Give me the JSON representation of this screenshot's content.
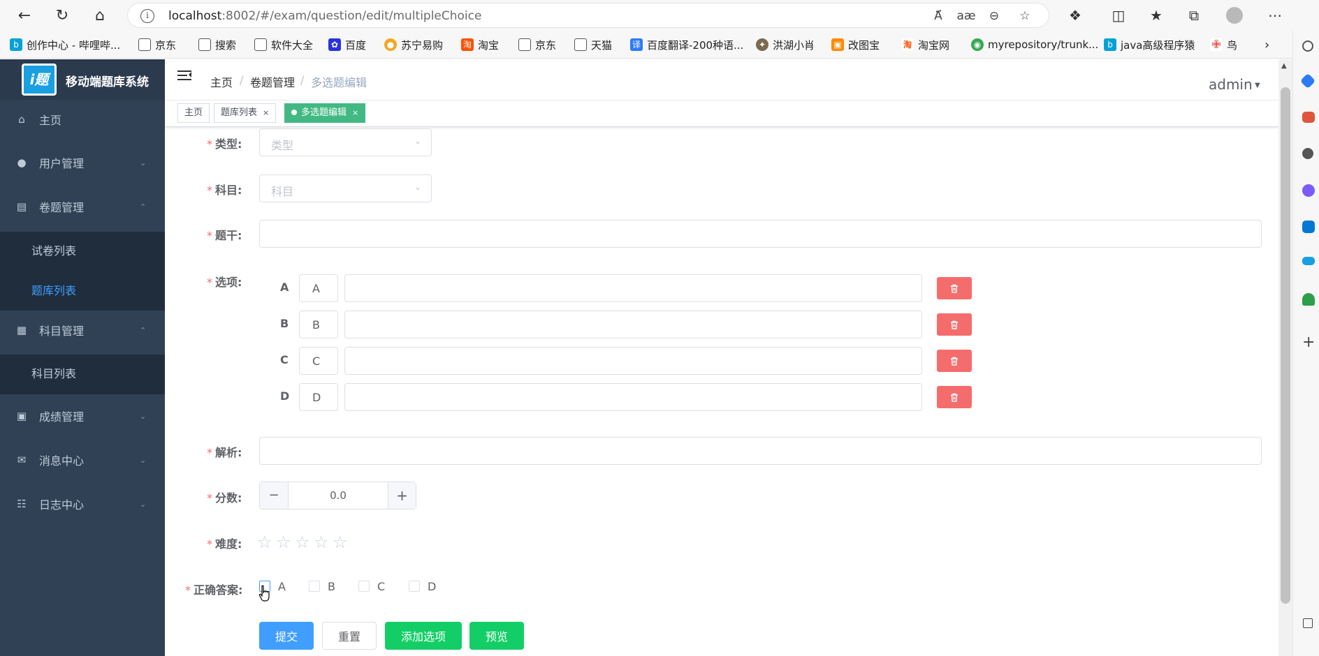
{
  "browser": {
    "url_host": "localhost",
    "url_path": ":8002/#/exam/question/edit/multipleChoice",
    "bookmarks": [
      "创作中心 - 哔哩哔...",
      "京东",
      "搜索",
      "软件大全",
      "百度",
      "苏宁易购",
      "淘宝",
      "京东",
      "天猫",
      "百度翻译-200种语...",
      "洪湖小肖",
      "改图宝",
      "淘宝网",
      "myrepository/trunk...",
      "java高级程序猿",
      "鸟"
    ]
  },
  "app": {
    "logo_text": "i题",
    "title": "移动端题库系统"
  },
  "sidebar": {
    "items": [
      {
        "label": "主页",
        "icon": "home-icon"
      },
      {
        "label": "用户管理",
        "icon": "user-icon"
      },
      {
        "label": "卷题管理",
        "icon": "document-icon"
      },
      {
        "label": "科目管理",
        "icon": "book-icon"
      },
      {
        "label": "成绩管理",
        "icon": "chat-icon"
      },
      {
        "label": "消息中心",
        "icon": "mail-icon"
      },
      {
        "label": "日志中心",
        "icon": "log-icon"
      }
    ],
    "exam_sub": [
      "试卷列表",
      "题库列表"
    ],
    "subject_sub": [
      "科目列表"
    ]
  },
  "header": {
    "breadcrumb": [
      "主页",
      "卷题管理",
      "多选题编辑"
    ],
    "user": "admin"
  },
  "tags": [
    {
      "label": "主页"
    },
    {
      "label": "题库列表",
      "close": "×"
    },
    {
      "label": "多选题编辑",
      "close": "×"
    }
  ],
  "form": {
    "type_label": "类型:",
    "type_placeholder": "类型",
    "subject_label": "科目:",
    "subject_placeholder": "科目",
    "stem_label": "题干:",
    "options_label": "选项:",
    "options": [
      {
        "prefix": "A",
        "key": "A"
      },
      {
        "prefix": "B",
        "key": "B"
      },
      {
        "prefix": "C",
        "key": "C"
      },
      {
        "prefix": "D",
        "key": "D"
      }
    ],
    "analysis_label": "解析:",
    "score_label": "分数:",
    "score_value": "0.0",
    "minus": "−",
    "plus": "+",
    "difficulty_label": "难度:",
    "difficulty_rating": 0,
    "difficulty_max": 5,
    "answer_label": "正确答案:",
    "answer_choices": [
      "A",
      "B",
      "C",
      "D"
    ]
  },
  "buttons": {
    "submit": "提交",
    "reset": "重置",
    "add_option": "添加选项",
    "preview": "预览"
  },
  "colors": {
    "sidebar_bg": "#304156",
    "active_blue": "#409eff",
    "tag_active": "#42b983",
    "danger": "#f56c6c",
    "success": "#13ce66"
  }
}
